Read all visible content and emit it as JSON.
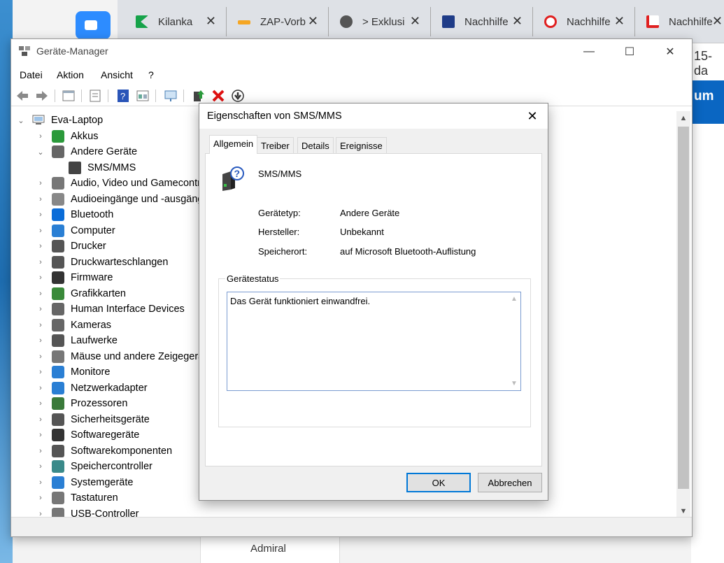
{
  "browser": {
    "tabs": [
      {
        "label": "Kilanka",
        "close": "✕"
      },
      {
        "label": "ZAP-Vorb",
        "close": "✕"
      },
      {
        "label": "> Exklusi",
        "close": "✕"
      },
      {
        "label": "Nachhilfe",
        "close": "✕"
      },
      {
        "label": "Nachhilfe",
        "close": "✕"
      },
      {
        "label": "Nachhilfe",
        "close": "✕"
      }
    ],
    "right_fragment": "15-da",
    "right_bar_text": "um",
    "bottom_text": "Admiral"
  },
  "device_manager": {
    "title": "Geräte-Manager",
    "window_buttons": {
      "minimize": "—",
      "maximize": "☐",
      "close": "✕"
    },
    "menu": [
      "Datei",
      "Aktion",
      "Ansicht",
      "?"
    ],
    "tree": {
      "root": "Eva-Laptop",
      "items": [
        {
          "label": "Akkus",
          "expanded": false
        },
        {
          "label": "Andere Geräte",
          "expanded": true,
          "children": [
            "SMS/MMS"
          ]
        },
        {
          "label": "Audio, Video und Gamecontroller",
          "expanded": false
        },
        {
          "label": "Audioeingänge und -ausgänge",
          "expanded": false
        },
        {
          "label": "Bluetooth",
          "expanded": false
        },
        {
          "label": "Computer",
          "expanded": false
        },
        {
          "label": "Drucker",
          "expanded": false
        },
        {
          "label": "Druckwarteschlangen",
          "expanded": false
        },
        {
          "label": "Firmware",
          "expanded": false
        },
        {
          "label": "Grafikkarten",
          "expanded": false
        },
        {
          "label": "Human Interface Devices",
          "expanded": false
        },
        {
          "label": "Kameras",
          "expanded": false
        },
        {
          "label": "Laufwerke",
          "expanded": false
        },
        {
          "label": "Mäuse und andere Zeigegeräte",
          "expanded": false
        },
        {
          "label": "Monitore",
          "expanded": false
        },
        {
          "label": "Netzwerkadapter",
          "expanded": false
        },
        {
          "label": "Prozessoren",
          "expanded": false
        },
        {
          "label": "Sicherheitsgeräte",
          "expanded": false
        },
        {
          "label": "Softwaregeräte",
          "expanded": false
        },
        {
          "label": "Softwarekomponenten",
          "expanded": false
        },
        {
          "label": "Speichercontroller",
          "expanded": false
        },
        {
          "label": "Systemgeräte",
          "expanded": false
        },
        {
          "label": "Tastaturen",
          "expanded": false
        },
        {
          "label": "USB-Controller",
          "expanded": false
        }
      ]
    }
  },
  "dialog": {
    "title": "Eigenschaften von SMS/MMS",
    "close": "✕",
    "tabs": [
      "Allgemein",
      "Treiber",
      "Details",
      "Ereignisse"
    ],
    "active_tab": "Allgemein",
    "device_name": "SMS/MMS",
    "properties": [
      {
        "label": "Gerätetyp:",
        "value": "Andere Geräte"
      },
      {
        "label": "Hersteller:",
        "value": "Unbekannt"
      },
      {
        "label": "Speicherort:",
        "value": "auf Microsoft Bluetooth-Auflistung"
      }
    ],
    "status_group_label": "Gerätestatus",
    "status_text": "Das Gerät funktioniert einwandfrei.",
    "ok_label": "OK",
    "cancel_label": "Abbrechen"
  }
}
